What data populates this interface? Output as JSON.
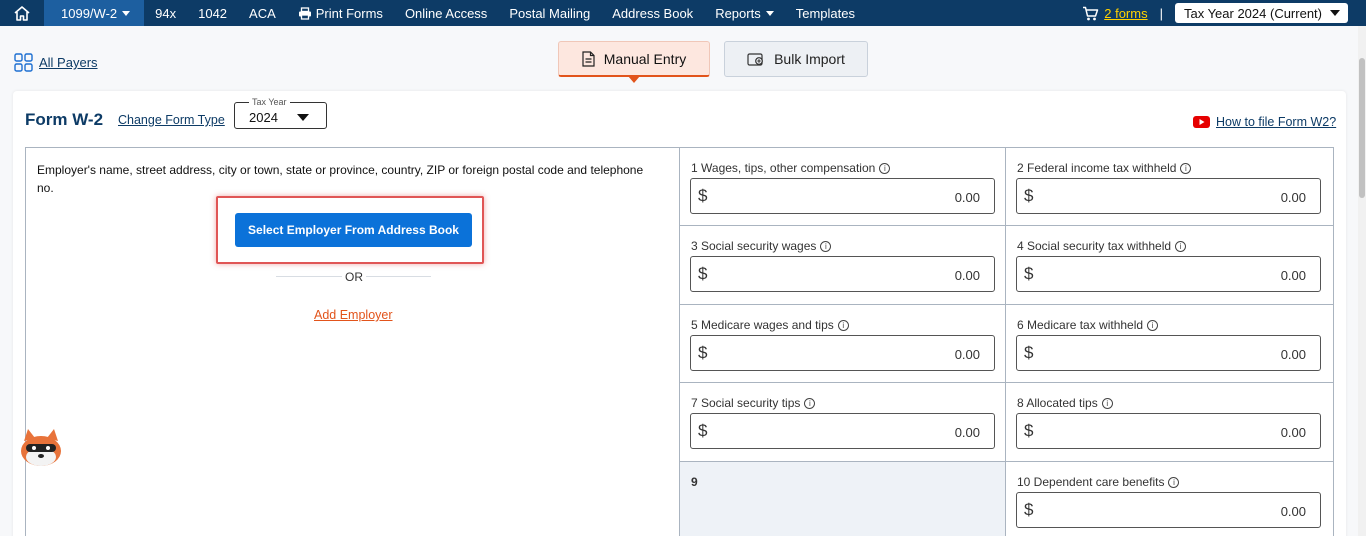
{
  "nav": {
    "items": [
      {
        "label": "1099/W-2",
        "active": true,
        "dropdown": true
      },
      {
        "label": "94x"
      },
      {
        "label": "1042"
      },
      {
        "label": "ACA"
      },
      {
        "label": "Print Forms",
        "icon": "printer-icon"
      },
      {
        "label": "Online Access"
      },
      {
        "label": "Postal Mailing"
      },
      {
        "label": "Address Book"
      },
      {
        "label": "Reports",
        "dropdown": true
      },
      {
        "label": "Templates"
      }
    ],
    "cart_label": "2 forms",
    "tax_year_label": "Tax Year 2024 (Current)"
  },
  "all_payers_label": "All Payers",
  "tabs": {
    "manual": "Manual Entry",
    "bulk": "Bulk Import"
  },
  "form": {
    "title": "Form W-2",
    "change_type": "Change Form Type",
    "tax_year_legend": "Tax Year",
    "tax_year_value": "2024",
    "howto": "How to file Form W2?",
    "employer_label": "Employer's name, street address, city or town, state or province, country, ZIP or foreign postal code and telephone no.",
    "select_employer_btn": "Select Employer From Address Book",
    "or_text": "OR",
    "add_employer": "Add Employer",
    "boxes": {
      "b1": {
        "label": "1  Wages, tips, other compensation",
        "value": "0.00"
      },
      "b2": {
        "label": "2  Federal income tax withheld",
        "value": "0.00"
      },
      "b3": {
        "label": "3  Social security wages",
        "value": "0.00"
      },
      "b4": {
        "label": "4   Social security tax withheld",
        "value": "0.00"
      },
      "b5": {
        "label": "5  Medicare wages and tips",
        "value": "0.00"
      },
      "b6": {
        "label": "6   Medicare tax withheld",
        "value": "0.00"
      },
      "b7": {
        "label": "7  Social security tips",
        "value": "0.00"
      },
      "b8": {
        "label": "8   Allocated tips",
        "value": "0.00"
      },
      "b9": {
        "label": "9"
      },
      "b10": {
        "label": "10  Dependent care benefits",
        "value": "0.00"
      }
    },
    "currency_symbol": "$"
  },
  "colors": {
    "nav_bg": "#0d3b66",
    "nav_active": "#1d5fa0",
    "primary_button": "#0b72d9",
    "accent_orange": "#e2541b",
    "highlight_red": "#e05555",
    "cart_yellow": "#ffd200"
  }
}
